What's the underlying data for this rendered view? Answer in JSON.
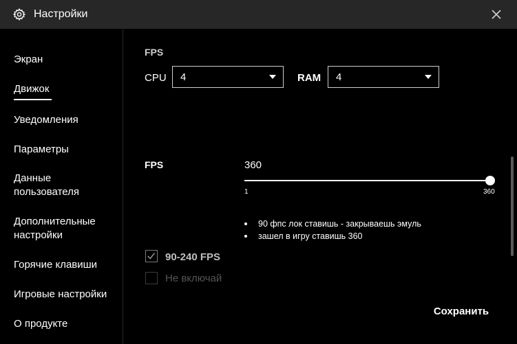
{
  "window": {
    "title": "Настройки",
    "icon": "gear-icon",
    "close_icon": "close-icon"
  },
  "sidebar": {
    "items": [
      {
        "label": "Экран",
        "active": false
      },
      {
        "label": "Движок",
        "active": true
      },
      {
        "label": "Уведомления",
        "active": false
      },
      {
        "label": "Параметры",
        "active": false
      },
      {
        "label": "Данные пользователя",
        "active": false
      },
      {
        "label": "Дополнительные настройки",
        "active": false
      },
      {
        "label": "Горячие клавиши",
        "active": false
      },
      {
        "label": "Игровые настройки",
        "active": false
      },
      {
        "label": "О продукте",
        "active": false
      }
    ]
  },
  "main": {
    "fps_section_title": "FPS",
    "cpu": {
      "label": "CPU",
      "value": "4"
    },
    "ram": {
      "label": "RAM",
      "value": "4"
    },
    "fps_slider": {
      "label": "FPS",
      "value": "360",
      "min_label": "1",
      "max_label": "360",
      "fraction": 1.0
    },
    "notes": [
      "90 фпс лок ставишь - закрываешь эмуль",
      "зашел в игру ставишь 360"
    ],
    "checkboxes": [
      {
        "label": "90-240 FPS",
        "checked": true,
        "enabled": true
      },
      {
        "label": "Не включай",
        "checked": false,
        "enabled": false
      }
    ],
    "save_label": "Сохранить"
  },
  "colors": {
    "titlebar": "#272727",
    "background": "#000000",
    "text": "#ffffff",
    "disabled_text": "#555555"
  }
}
